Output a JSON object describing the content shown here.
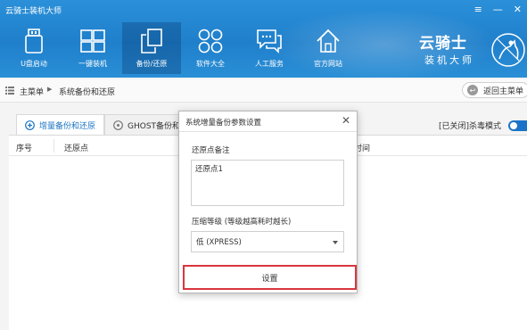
{
  "app": {
    "title": "云骑士装机大师"
  },
  "window_controls": {
    "menu": "≡",
    "minimize": "—",
    "close": "✕"
  },
  "nav": [
    {
      "label": "U盘启动",
      "icon": "usb-drive-icon"
    },
    {
      "label": "一键装机",
      "icon": "windows-icon"
    },
    {
      "label": "备份/还原",
      "icon": "backup-restore-icon",
      "active": true
    },
    {
      "label": "软件大全",
      "icon": "apps-grid-icon"
    },
    {
      "label": "人工服务",
      "icon": "chat-service-icon"
    },
    {
      "label": "官方网站",
      "icon": "home-icon"
    }
  ],
  "logo": {
    "line1": "云骑士",
    "line2": "装机大师",
    "icon": "knight-emblem-icon"
  },
  "breadcrumb": {
    "home": "主菜单",
    "separator": "▶",
    "current": "系统备份和还原"
  },
  "back_button": {
    "label": "返回主菜单",
    "icon": "back-arrow-icon"
  },
  "tabs": [
    {
      "label": "增量备份和还原",
      "icon": "incremental-backup-icon",
      "active": true
    },
    {
      "label": "GHOST备份和还",
      "icon": "ghost-disc-icon"
    }
  ],
  "kill_mode": {
    "status": "[已关闭]",
    "label": "杀毒模式"
  },
  "table": {
    "columns": [
      "序号",
      "还原点",
      "时间"
    ]
  },
  "dialog": {
    "title": "系统增量备份参数设置",
    "close": "✕",
    "note_label": "还原点备注",
    "note_value": "还原点1",
    "compress_label": "压缩等级 (等级越高耗时越长)",
    "compress_value": "低 (XPRESS)",
    "submit": "设置"
  },
  "colors": {
    "header": "#1f7fcb",
    "accent": "#1c75c4",
    "highlight_border": "#d9363e"
  }
}
